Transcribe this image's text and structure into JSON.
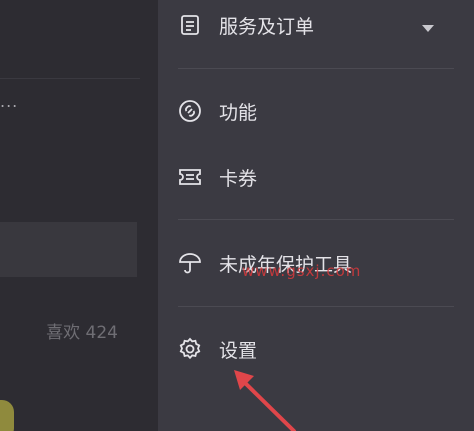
{
  "background_page": {
    "dots": "...",
    "likes_text": "喜欢 424"
  },
  "drawer": {
    "items": [
      {
        "label": "服务及订单",
        "icon": "document-icon"
      },
      {
        "label": "功能",
        "icon": "link-icon"
      },
      {
        "label": "卡券",
        "icon": "ticket-icon"
      },
      {
        "label": "未成年保护工具",
        "icon": "umbrella-icon"
      },
      {
        "label": "设置",
        "icon": "gear-icon"
      }
    ]
  },
  "watermark": "www.gsxj.com",
  "colors": {
    "drawer_bg": "#3b3a42",
    "page_bg": "#2d2c32",
    "text": "#e4e3e8",
    "annotation_arrow": "#e0464a"
  }
}
